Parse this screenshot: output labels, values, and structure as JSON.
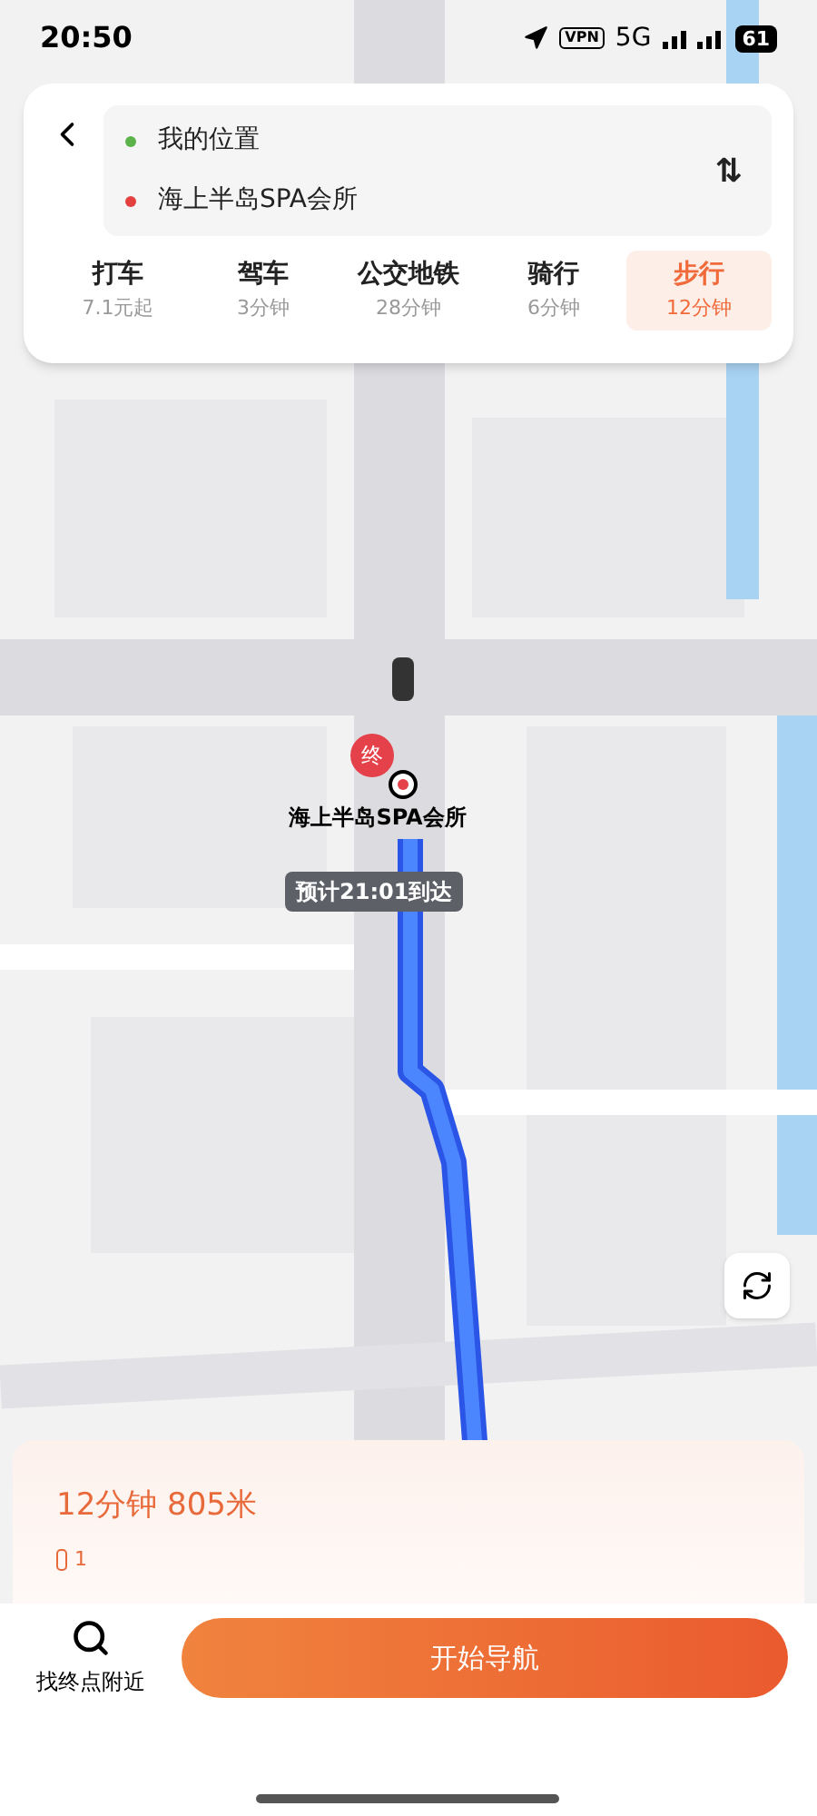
{
  "status_bar": {
    "time": "20:50",
    "vpn": "VPN",
    "network": "5G",
    "battery": "61"
  },
  "route_panel": {
    "origin": "我的位置",
    "destination": "海上半岛SPA会所",
    "swap": "⇅"
  },
  "modes": [
    {
      "name": "打车",
      "info": "7.1元起",
      "selected": false
    },
    {
      "name": "驾车",
      "info": "3分钟",
      "selected": false
    },
    {
      "name": "公交地铁",
      "info": "28分钟",
      "selected": false
    },
    {
      "name": "骑行",
      "info": "6分钟",
      "selected": false
    },
    {
      "name": "步行",
      "info": "12分钟",
      "selected": true
    }
  ],
  "map": {
    "end_marker": "终",
    "destination_name": "海上半岛SPA会所",
    "eta": "预计21:01到达"
  },
  "summary": {
    "title": "12分钟 805米",
    "traffic_lights": "1"
  },
  "footer": {
    "nearby": "找终点附近",
    "start": "开始导航"
  }
}
